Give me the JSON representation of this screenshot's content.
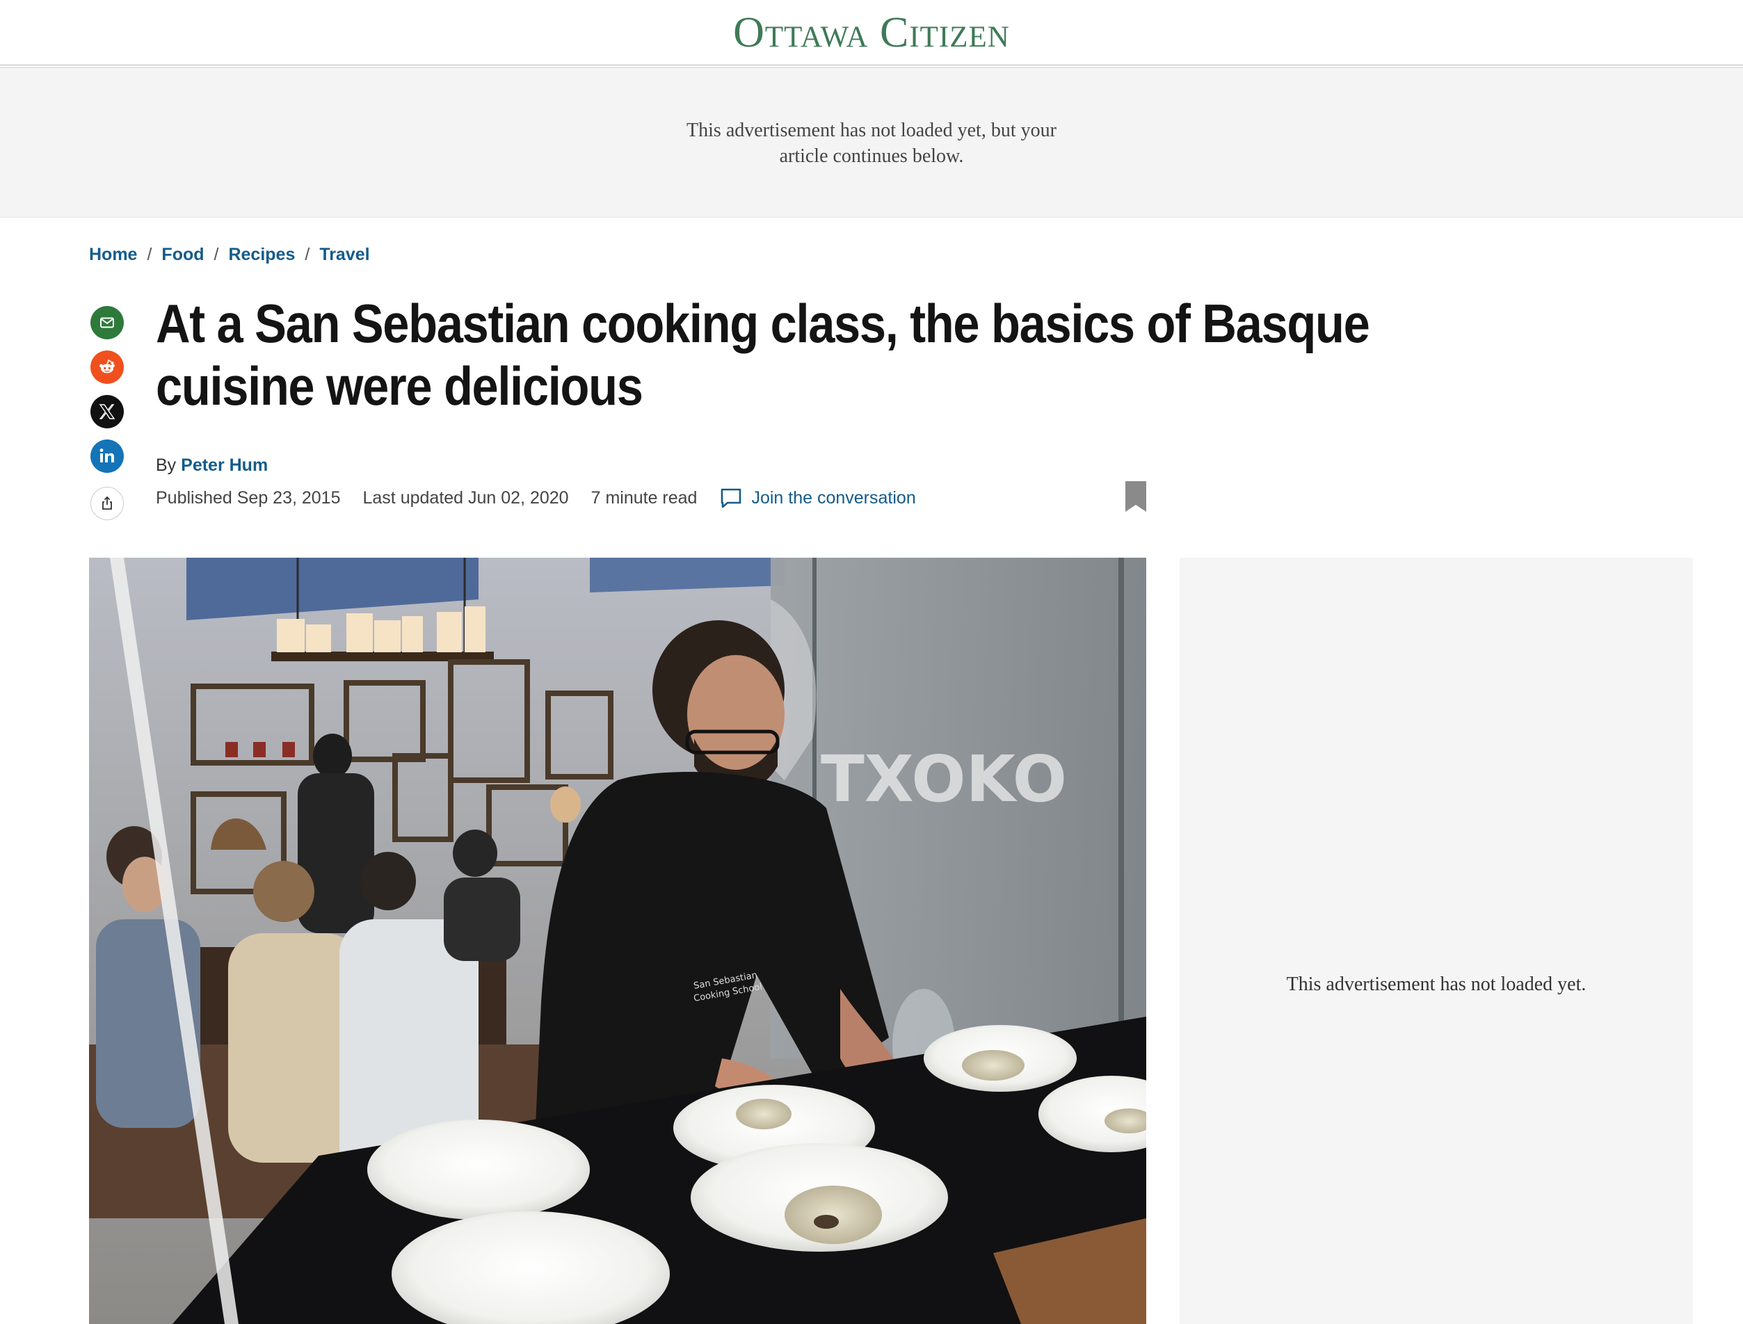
{
  "masthead": {
    "logo": "Ottawa Citizen"
  },
  "ad_top": {
    "line1": "This advertisement has not loaded yet, but your",
    "line2": "article continues below."
  },
  "breadcrumb": {
    "items": [
      "Home",
      "Food",
      "Recipes",
      "Travel"
    ],
    "separator": "/"
  },
  "share": {
    "items": [
      {
        "name": "email",
        "icon": "mail-icon",
        "color": "#2e7a3a"
      },
      {
        "name": "reddit",
        "icon": "reddit-icon",
        "color": "#f0501e"
      },
      {
        "name": "x",
        "icon": "x-icon",
        "color": "#111111"
      },
      {
        "name": "linkedin",
        "icon": "linkedin-icon",
        "color": "#1474b8"
      },
      {
        "name": "share",
        "icon": "share-icon",
        "color": "#ffffff"
      }
    ]
  },
  "article": {
    "headline": "At a San Sebastian cooking class, the basics of Basque cuisine were delicious",
    "by_prefix": "By",
    "author": "Peter Hum",
    "published": "Published Sep 23, 2015",
    "updated": "Last updated Jun 02, 2020",
    "read_time": "7 minute read",
    "join_label": "Join the conversation",
    "bookmark_icon": "bookmark-icon"
  },
  "hero": {
    "signage": "TXOKO",
    "apron_text_1": "San Sebastian",
    "apron_text_2": "Cooking School"
  },
  "ad_side": {
    "text": "This advertisement has not loaded yet."
  },
  "colors": {
    "link": "#155b8b",
    "logo": "#3f7a57",
    "headline": "#141414",
    "ad_bg": "#f4f4f4"
  }
}
